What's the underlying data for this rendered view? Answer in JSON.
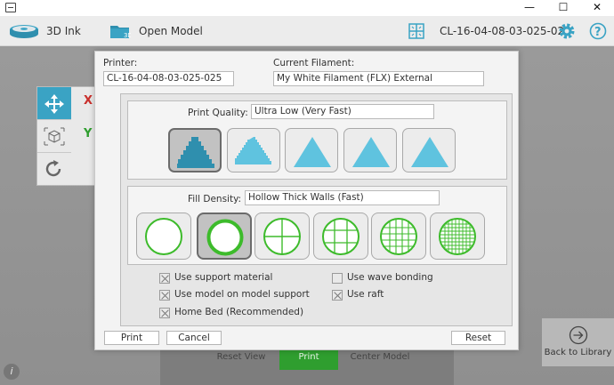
{
  "window": {
    "minimize": "—",
    "maximize": "☐",
    "close": "✕"
  },
  "toolbar": {
    "ink_label": "3D Ink",
    "open_model_label": "Open Model",
    "printer_id": "CL-16-04-08-03-025-025"
  },
  "viewport": {
    "axis_x": "X",
    "axis_y": "Y",
    "reset_view": "Reset View",
    "print": "Print",
    "center_model": "Center Model",
    "back_to_library": "Back to Library",
    "info": "i"
  },
  "dialog": {
    "printer_label": "Printer:",
    "printer_value": "CL-16-04-08-03-025-025",
    "filament_label": "Current Filament:",
    "filament_value": "My White Filament (FLX) External",
    "quality_label": "Print Quality:",
    "quality_value": "Ultra Low (Very Fast)",
    "quality_selected_index": 0,
    "fill_label": "Fill Density:",
    "fill_value": "Hollow Thick Walls (Fast)",
    "fill_selected_index": 1,
    "options": [
      {
        "label": "Use support material",
        "checked": true
      },
      {
        "label": "Use model on model support",
        "checked": true
      },
      {
        "label": "Home Bed (Recommended)",
        "checked": true
      },
      {
        "label": "Use wave bonding",
        "checked": false
      },
      {
        "label": "Use raft",
        "checked": true
      }
    ],
    "buttons": {
      "print": "Print",
      "cancel": "Cancel",
      "reset": "Reset"
    }
  },
  "colors": {
    "accent_blue": "#3aa3c4",
    "fill_green": "#3dbb2b",
    "print_green": "#2f9e2f"
  }
}
